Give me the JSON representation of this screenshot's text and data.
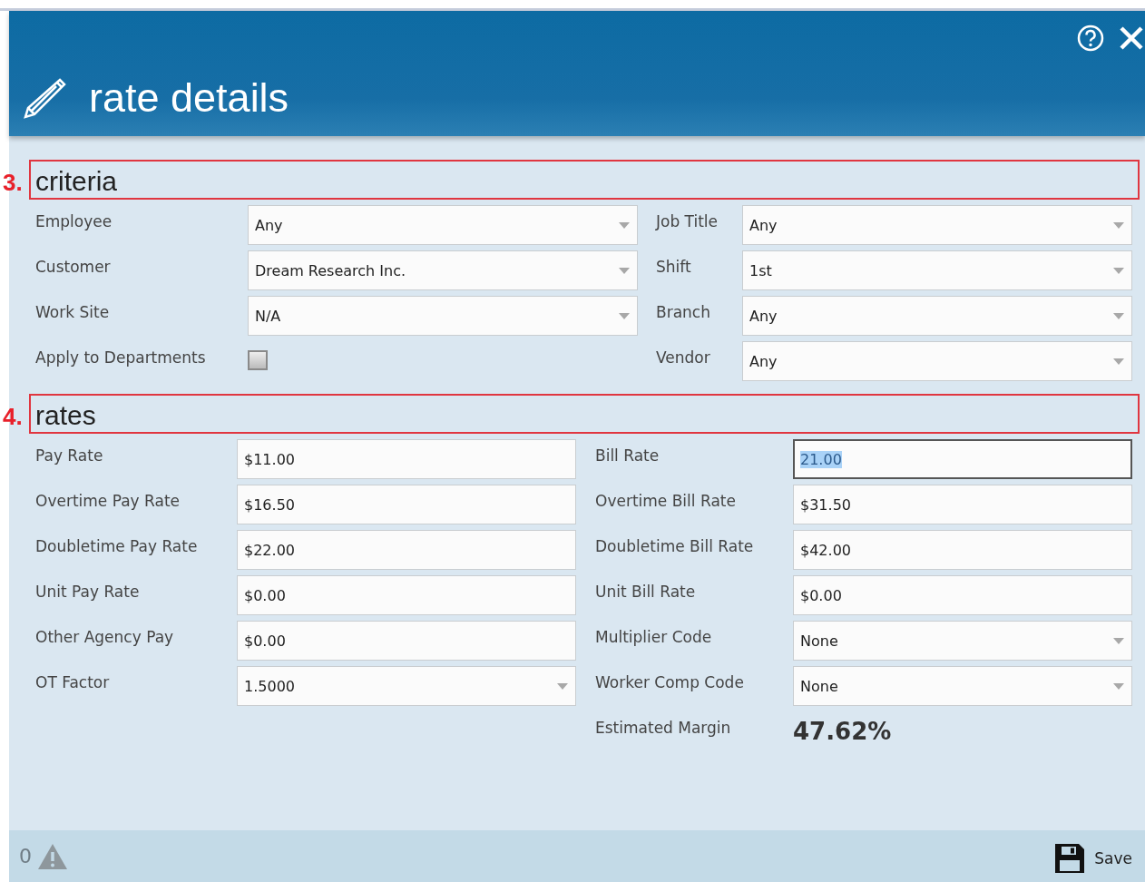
{
  "window": {
    "title": "rate details"
  },
  "criteria": {
    "marker": "3.",
    "title": "criteria",
    "rows": [
      {
        "left": {
          "label": "Employee",
          "kind": "dropdown",
          "value": "Any"
        },
        "right": {
          "label": "Job Title",
          "kind": "dropdown",
          "value": "Any"
        }
      },
      {
        "left": {
          "label": "Customer",
          "kind": "dropdown",
          "value": "Dream Research Inc."
        },
        "right": {
          "label": "Shift",
          "kind": "dropdown",
          "value": "1st"
        }
      },
      {
        "left": {
          "label": "Work Site",
          "kind": "dropdown",
          "value": "N/A"
        },
        "right": {
          "label": "Branch",
          "kind": "dropdown",
          "value": "Any"
        }
      },
      {
        "left": {
          "label": "Apply to Departments",
          "kind": "checkbox",
          "checked": false
        },
        "right": {
          "label": "Vendor",
          "kind": "dropdown",
          "value": "Any"
        }
      }
    ]
  },
  "rates": {
    "marker": "4.",
    "title": "rates",
    "rows": [
      {
        "left": {
          "label": "Pay Rate",
          "kind": "text",
          "value": "$11.00",
          "focused": false
        },
        "right": {
          "label": "Bill Rate",
          "kind": "text",
          "value": "21.00",
          "focused": true
        }
      },
      {
        "left": {
          "label": "Overtime Pay Rate",
          "kind": "text",
          "value": "$16.50",
          "focused": false
        },
        "right": {
          "label": "Overtime Bill Rate",
          "kind": "text",
          "value": "$31.50",
          "focused": false
        }
      },
      {
        "left": {
          "label": "Doubletime Pay Rate",
          "kind": "text",
          "value": "$22.00",
          "focused": false
        },
        "right": {
          "label": "Doubletime Bill Rate",
          "kind": "text",
          "value": "$42.00",
          "focused": false
        }
      },
      {
        "left": {
          "label": "Unit Pay Rate",
          "kind": "text",
          "value": "$0.00",
          "focused": false
        },
        "right": {
          "label": "Unit Bill Rate",
          "kind": "text",
          "value": "$0.00",
          "focused": false
        }
      },
      {
        "left": {
          "label": "Other Agency Pay",
          "kind": "text",
          "value": "$0.00",
          "focused": false
        },
        "right": {
          "label": "Multiplier Code",
          "kind": "dropdown",
          "value": "None"
        }
      },
      {
        "left": {
          "label": "OT Factor",
          "kind": "dropdown",
          "value": "1.5000"
        },
        "right": {
          "label": "Worker Comp Code",
          "kind": "dropdown",
          "value": "None"
        }
      },
      {
        "right": {
          "label": "Estimated Margin",
          "kind": "readout",
          "value": "47.62%"
        }
      }
    ]
  },
  "footer": {
    "warning_count": "0",
    "save_button": "Save"
  }
}
